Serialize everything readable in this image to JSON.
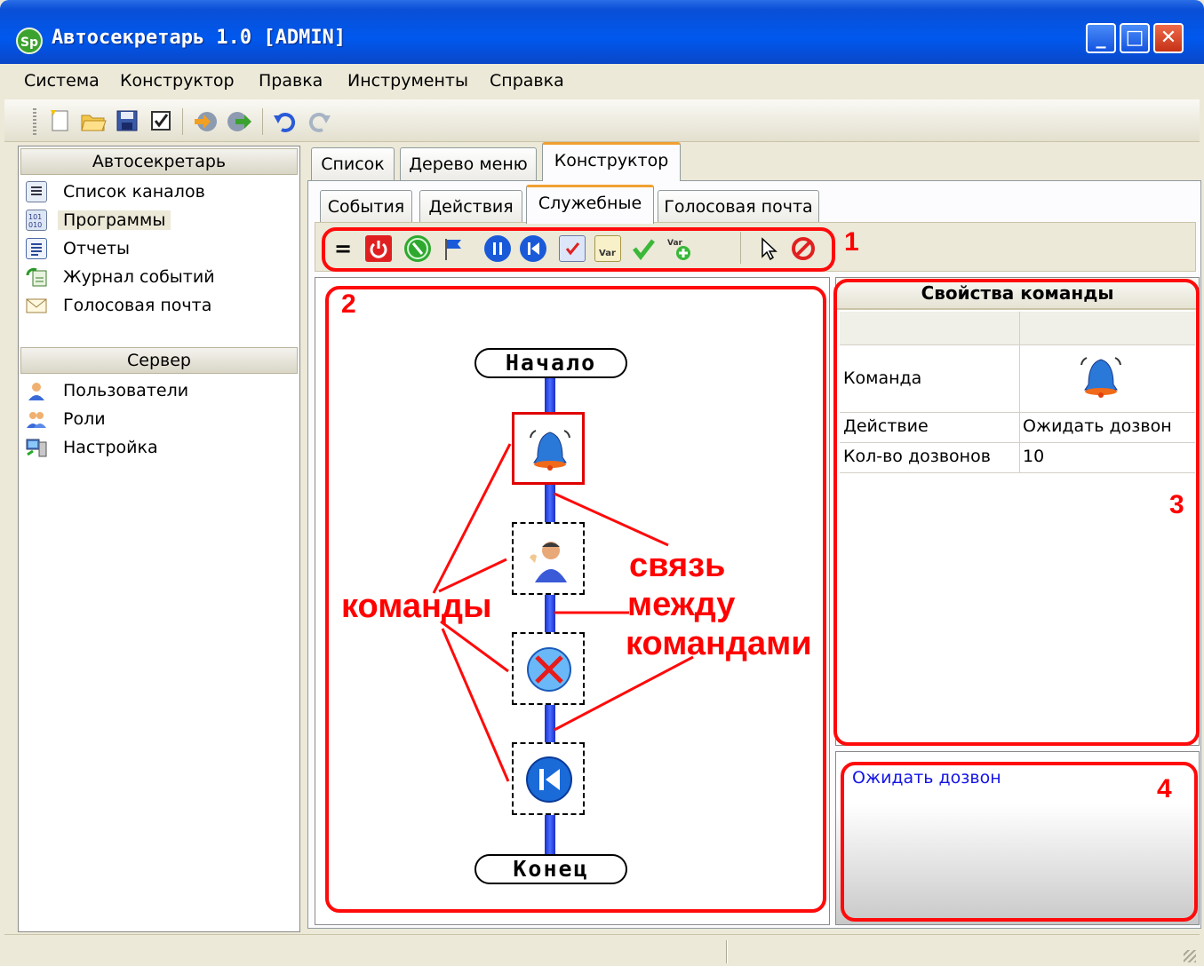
{
  "window": {
    "logo": "Sp",
    "title": "Автосекретарь 1.0 [ADMIN]",
    "minimize": "_",
    "maximize": "□",
    "close": "✕"
  },
  "menu": [
    "Система",
    "Конструктор",
    "Правка",
    "Инструменты",
    "Справка"
  ],
  "toolbar_icons": [
    "new-document-icon",
    "open-folder-icon",
    "save-icon",
    "checklist-icon",
    "import-icon",
    "export-icon",
    "undo-icon",
    "redo-icon"
  ],
  "left_pane": {
    "group1": {
      "header": "Автосекретарь",
      "items": [
        {
          "label": "Список каналов",
          "icon": "list-icon"
        },
        {
          "label": "Программы",
          "icon": "program-icon"
        },
        {
          "label": "Отчеты",
          "icon": "report-icon"
        },
        {
          "label": "Журнал событий",
          "icon": "event-log-icon"
        },
        {
          "label": "Голосовая почта",
          "icon": "mail-icon"
        }
      ]
    },
    "group2": {
      "header": "Сервер",
      "items": [
        {
          "label": "Пользователи",
          "icon": "user-icon"
        },
        {
          "label": "Роли",
          "icon": "roles-icon"
        },
        {
          "label": "Настройка",
          "icon": "settings-icon"
        }
      ]
    }
  },
  "tabs": [
    "Список",
    "Дерево меню",
    "Конструктор"
  ],
  "subtabs": [
    "События",
    "Действия",
    "Служебные",
    "Голосовая почта"
  ],
  "command_icons": [
    "equals-icon",
    "power-icon",
    "globe-icon",
    "flag-icon",
    "pause-icon",
    "back-icon",
    "check-doc-icon",
    "var-icon",
    "checkmark-icon",
    "add-var-icon",
    "pointer-icon",
    "forbidden-icon"
  ],
  "command_eq": "=",
  "flow": {
    "start": "Начало",
    "end": "Конец",
    "nodes": [
      "bell-icon",
      "operator-icon",
      "cancel-icon",
      "back-icon"
    ]
  },
  "properties": {
    "title": "Свойства команды",
    "rows": [
      {
        "key": "Команда",
        "value": ""
      },
      {
        "key": "Действие",
        "value": "Ожидать дозвон"
      },
      {
        "key": "Кол-во дозвонов",
        "value": "10"
      }
    ]
  },
  "hint": "Ожидать дозвон",
  "annotations": {
    "num1": "1",
    "num2": "2",
    "num3": "3",
    "num4": "4",
    "commands": "команды",
    "link_line1": "связь",
    "link_line2": "между",
    "link_line3": "командами"
  },
  "colors": {
    "annotation_red": "#ff0a0a",
    "titlebar_blue": "#0058ee",
    "hint_blue": "#1414e6"
  }
}
